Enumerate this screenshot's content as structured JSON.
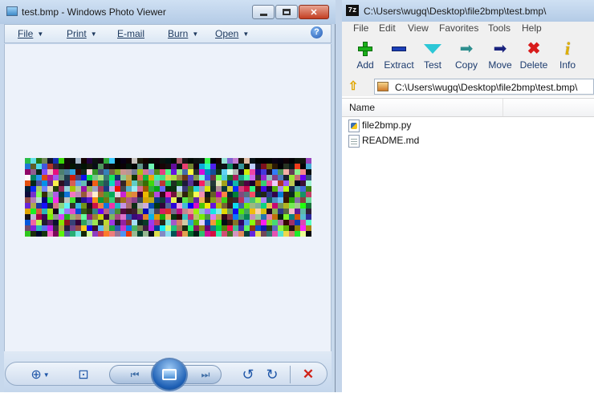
{
  "photo_viewer": {
    "title": "test.bmp - Windows Photo Viewer",
    "menu": {
      "file": "File",
      "print": "Print",
      "email": "E-mail",
      "burn": "Burn",
      "open": "Open"
    },
    "help_glyph": "?",
    "icons": {
      "zoom": "zoom-magnifier-icon",
      "actual_size": "actual-size-icon",
      "previous": "previous-icon",
      "slideshow": "slideshow-icon",
      "next": "next-icon",
      "rotate_ccw": "rotate-counterclockwise-icon",
      "rotate_cw": "rotate-clockwise-icon",
      "delete": "delete-x-icon"
    },
    "image": {
      "grid_cols": 51,
      "grid_rows": 14,
      "description_note": "noisy multicolored pixel grid"
    },
    "colors": {
      "chrome": "#c7d8ec",
      "canvas": "#edf2fa",
      "accent": "#1f56a8",
      "delete": "#d0231a"
    }
  },
  "sevenzip": {
    "title": "C:\\Users\\wugq\\Desktop\\file2bmp\\test.bmp\\",
    "app_icon_text": "7z",
    "menu": [
      "File",
      "Edit",
      "View",
      "Favorites",
      "Tools",
      "Help"
    ],
    "toolbar": [
      {
        "label": "Add",
        "icon": "add-plus-icon"
      },
      {
        "label": "Extract",
        "icon": "extract-minus-icon"
      },
      {
        "label": "Test",
        "icon": "test-check-icon"
      },
      {
        "label": "Copy",
        "icon": "copy-arrow-icon"
      },
      {
        "label": "Move",
        "icon": "move-arrow-icon"
      },
      {
        "label": "Delete",
        "icon": "delete-x-icon"
      },
      {
        "label": "Info",
        "icon": "info-i-icon"
      }
    ],
    "address": "C:\\Users\\wugq\\Desktop\\file2bmp\\test.bmp\\",
    "column_header": "Name",
    "files": [
      {
        "name": "file2bmp.py",
        "icon": "python-file-icon"
      },
      {
        "name": "README.md",
        "icon": "text-file-icon"
      }
    ]
  }
}
